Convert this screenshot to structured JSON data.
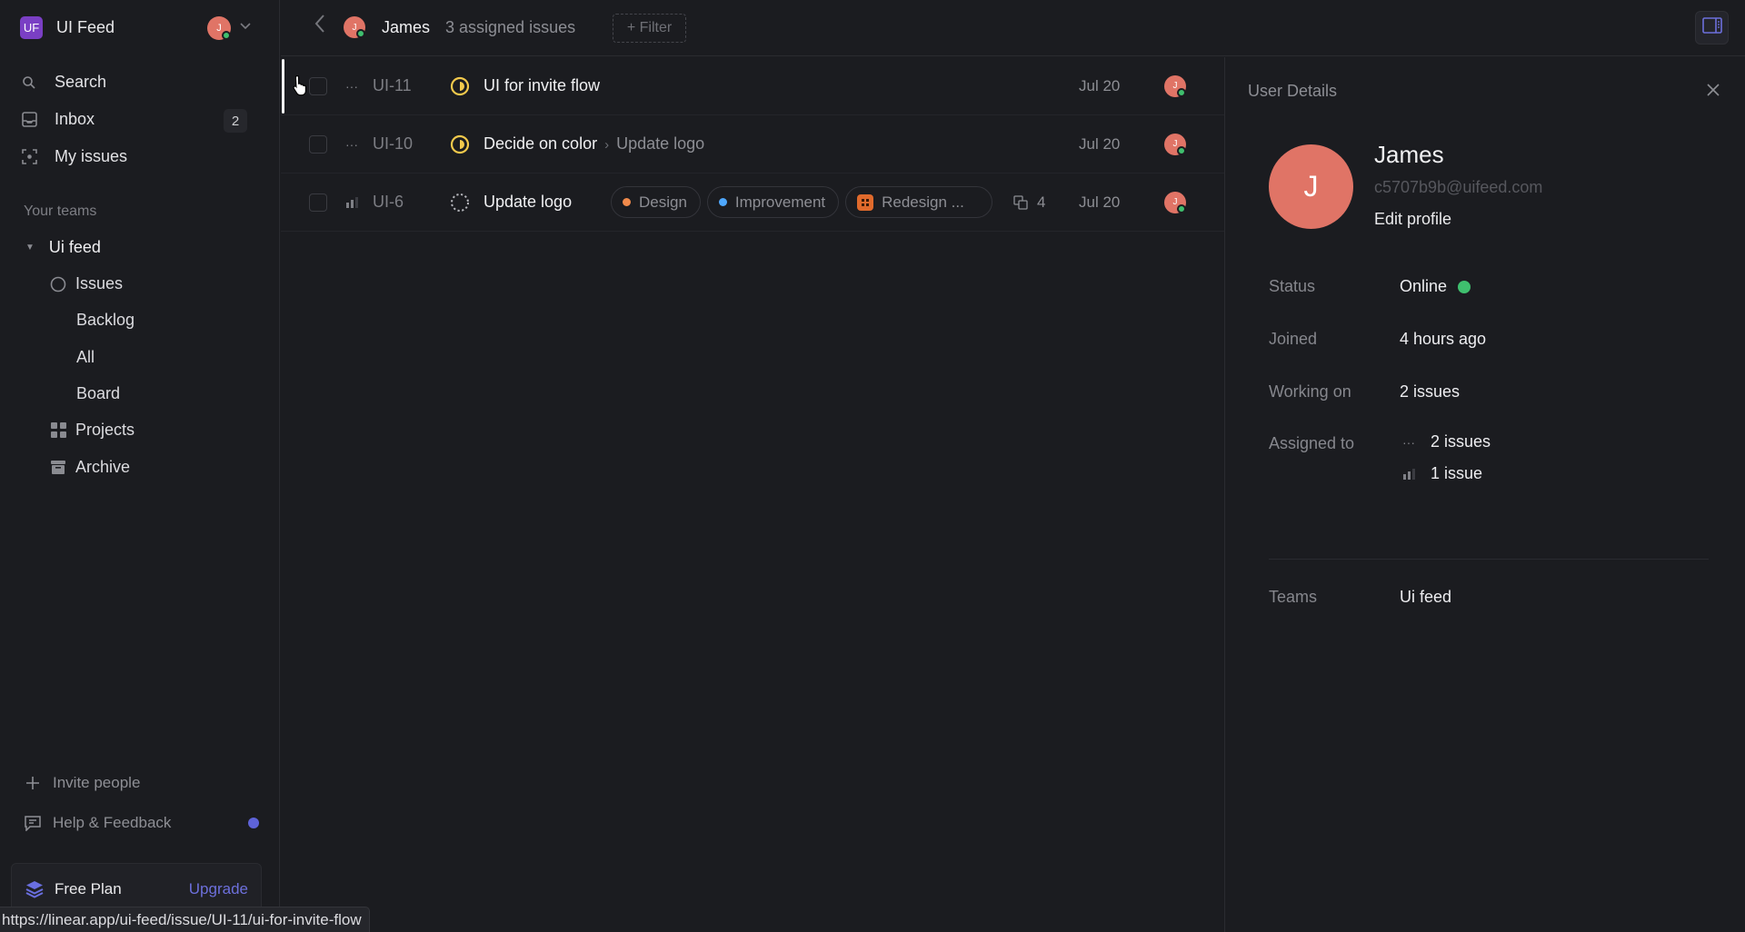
{
  "workspace": {
    "logo_text": "UF",
    "name": "UI Feed",
    "user_initial": "J",
    "logo_color": "#7a3fc4"
  },
  "nav": {
    "search": "Search",
    "inbox": "Inbox",
    "inbox_count": "2",
    "my_issues": "My issues"
  },
  "teams": {
    "section_label": "Your teams",
    "team_name": "Ui feed",
    "items": {
      "issues": "Issues",
      "backlog": "Backlog",
      "all": "All",
      "board": "Board",
      "projects": "Projects",
      "archive": "Archive"
    }
  },
  "sidebar_bottom": {
    "invite": "Invite people",
    "help": "Help & Feedback",
    "plan_name": "Free Plan",
    "upgrade": "Upgrade"
  },
  "status_bar_url": "https://linear.app/ui-feed/issue/UI-11/ui-for-invite-flow",
  "header": {
    "user_initial": "J",
    "user_name": "James",
    "count_text": "3 assigned issues",
    "filter_label": "+ Filter"
  },
  "issues": [
    {
      "id": "UI-11",
      "priority": "no-priority",
      "status": "in-progress",
      "title": "UI for invite flow",
      "parent": "",
      "date": "Jul 20",
      "assignee_initial": "J"
    },
    {
      "id": "UI-10",
      "priority": "no-priority",
      "status": "in-progress",
      "title": "Decide on color",
      "parent": "Update logo",
      "date": "Jul 20",
      "assignee_initial": "J"
    },
    {
      "id": "UI-6",
      "priority": "medium",
      "status": "backlog",
      "title": "Update logo",
      "labels": [
        {
          "name": "Design",
          "color": "#f08a4b"
        },
        {
          "name": "Improvement",
          "color": "#4ea7fc"
        }
      ],
      "project": {
        "name": "Redesign ...",
        "color": "#e06a2c"
      },
      "sub_issue_count": "4",
      "date": "Jul 20",
      "assignee_initial": "J"
    }
  ],
  "details": {
    "title": "User Details",
    "initial": "J",
    "name": "James",
    "email": "c5707b9b@uifeed.com",
    "edit_profile": "Edit profile",
    "status_label": "Status",
    "status_value": "Online",
    "joined_label": "Joined",
    "joined_value": "4 hours ago",
    "working_label": "Working on",
    "working_value": "2 issues",
    "assigned_label": "Assigned to",
    "assigned": [
      {
        "priority": "no-priority",
        "value": "2 issues"
      },
      {
        "priority": "medium",
        "value": "1 issue"
      }
    ],
    "teams_label": "Teams",
    "teams_value": "Ui feed"
  },
  "colors": {
    "accent": "#6d70dc",
    "online": "#3fbf6e",
    "avatar": "#e07466",
    "in_progress": "#f2c94c"
  }
}
